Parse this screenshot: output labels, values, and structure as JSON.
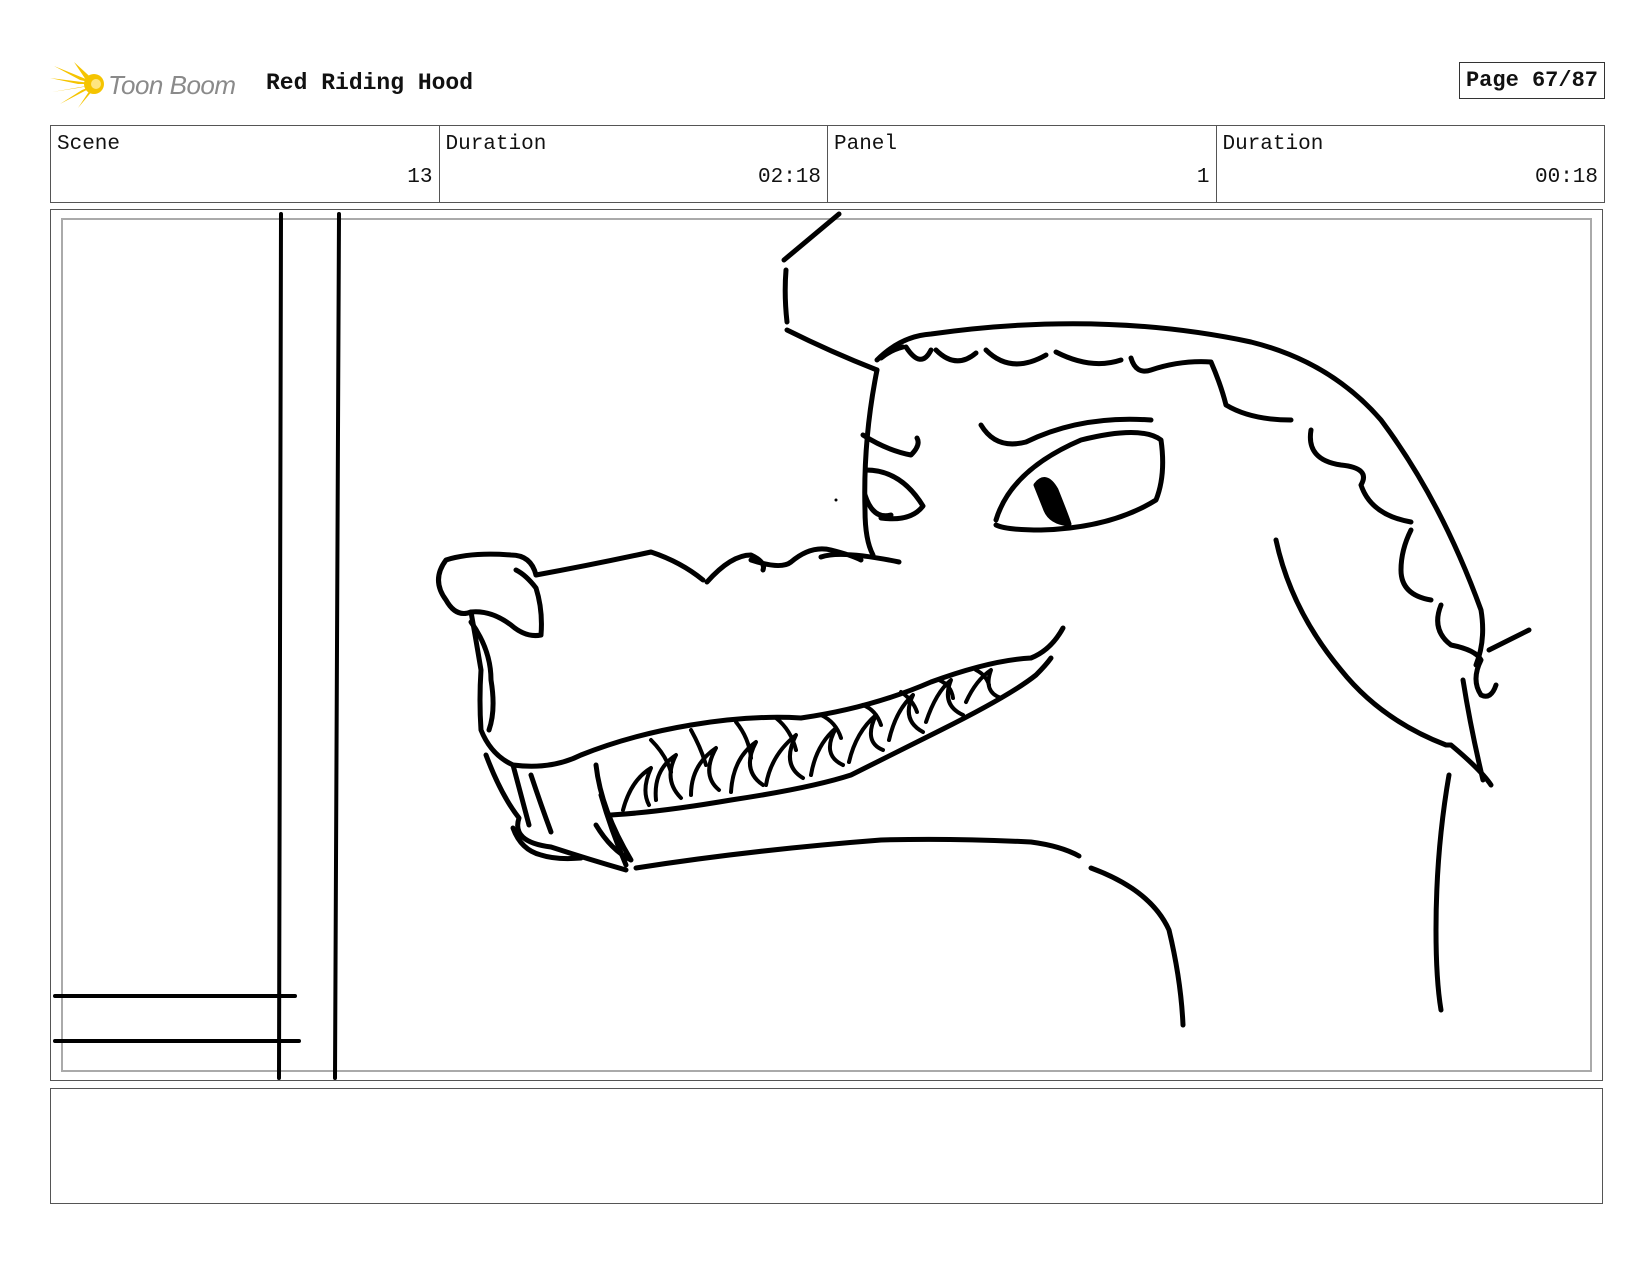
{
  "header": {
    "logo_text": "Toon Boom",
    "logo_icon": "starburst-logo-icon",
    "project_title": "Red Riding Hood",
    "page_label": "Page 67/87"
  },
  "info": {
    "scene_label": "Scene",
    "scene_value": "13",
    "duration_label": "Duration",
    "duration_value": "02:18",
    "panel_label": "Panel",
    "panel_value": "1",
    "panel_duration_label": "Duration",
    "panel_duration_value": "00:18"
  },
  "panel": {
    "description": "",
    "drawing": "wolf-head-sketch"
  },
  "notes": {
    "text": ""
  },
  "colors": {
    "logo_yellow": "#f5c400",
    "logo_text": "#8a8a8a",
    "border": "#555555",
    "ink": "#000000"
  }
}
